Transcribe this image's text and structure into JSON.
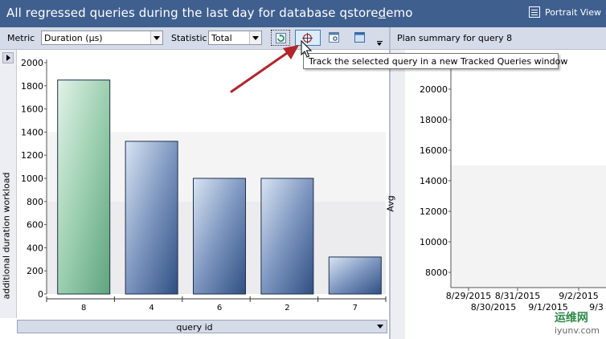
{
  "window": {
    "title_pre": "All regressed queries during the last day for database qstore",
    "title_underlined": "d",
    "title_post": "emo",
    "portrait_view_label": "Portrait View"
  },
  "toolbar": {
    "metric_label": "Metric",
    "metric_value": "Duration (µs)",
    "statistic_label": "Statistic",
    "statistic_value": "Total"
  },
  "tooltip": {
    "text": "Track the selected query in a new Tracked Queries window"
  },
  "right_panel": {
    "header": "Plan summary for query 8",
    "y_axis_label": "Avg"
  },
  "watermark": {
    "logo_text": "运维网",
    "site": "iyunv.com"
  },
  "x_axis_selector": "query id",
  "colors": {
    "title_bar": "#3f5f8f",
    "toolbar_bg": "#d6dbe9",
    "selected_bar": "#8cc4a2",
    "bar": "#3d5f91",
    "arrow": "#b3252b"
  },
  "chart_data": [
    {
      "type": "bar",
      "categories": [
        "8",
        "4",
        "6",
        "2",
        "7"
      ],
      "values": [
        1850,
        1320,
        1000,
        1000,
        320
      ],
      "selected_category": "8",
      "ylabel": "additional duration workload",
      "xlabel": "query id",
      "ylim": [
        0,
        2000
      ],
      "yticks": [
        0,
        200,
        400,
        600,
        800,
        1000,
        1200,
        1400,
        1600,
        1800,
        2000
      ],
      "grid": false
    },
    {
      "type": "line",
      "ylabel": "Avg",
      "yticks": [
        8000,
        10000,
        12000,
        14000,
        16000,
        18000,
        20000
      ],
      "xticks_upper": [
        "8/29/2015",
        "8/31/2015",
        "9/2/2015"
      ],
      "xticks_lower": [
        "8/30/2015",
        "9/1/2015",
        "9/3"
      ],
      "series": []
    }
  ]
}
